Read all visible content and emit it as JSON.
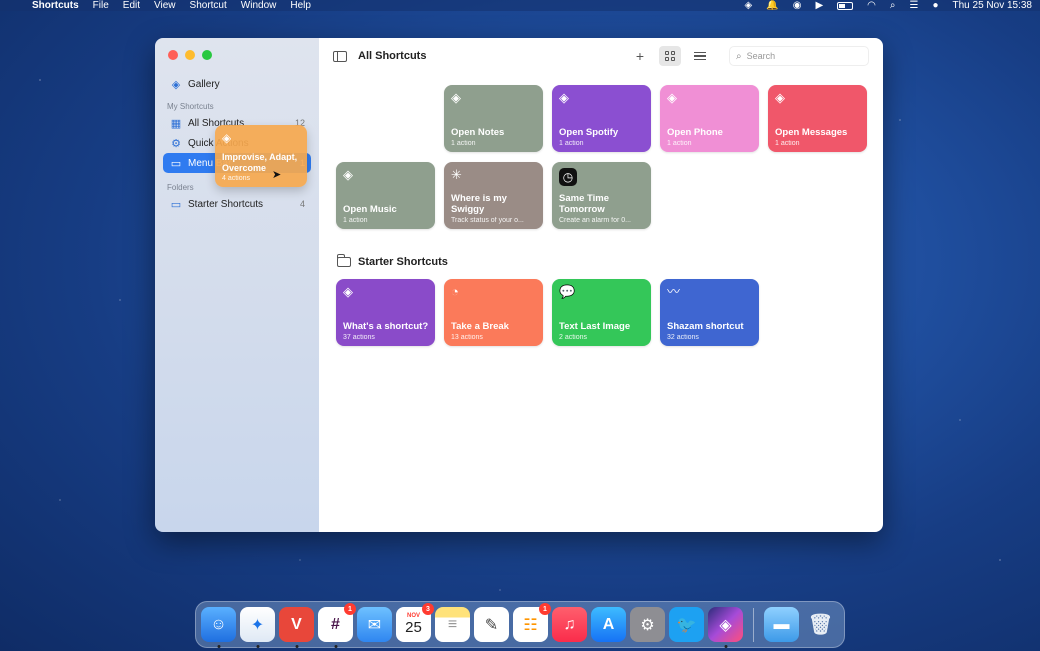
{
  "menubar": {
    "apple": "",
    "app_name": "Shortcuts",
    "menus": [
      "File",
      "Edit",
      "View",
      "Shortcut",
      "Window",
      "Help"
    ],
    "clock": "Thu 25 Nov 15:38"
  },
  "sidebar": {
    "gallery": "Gallery",
    "my_shortcuts_header": "My Shortcuts",
    "items": [
      {
        "label": "All Shortcuts",
        "count": "12"
      },
      {
        "label": "Quick Actions",
        "count": ""
      },
      {
        "label": "Menu Bar",
        "count": "1"
      }
    ],
    "folders_header": "Folders",
    "folders": [
      {
        "label": "Starter Shortcuts",
        "count": "4"
      }
    ]
  },
  "toolbar": {
    "title": "All Shortcuts",
    "add": "+",
    "search_placeholder": "Search"
  },
  "shortcuts": [
    {
      "title": "Open Notes",
      "sub": "1 action",
      "color": "#8f9f8e",
      "icon": "stack-icon"
    },
    {
      "title": "Open Spotify",
      "sub": "1 action",
      "color": "#8b4fd1",
      "icon": "stack-icon"
    },
    {
      "title": "Open Phone",
      "sub": "1 action",
      "color": "#f08fd5",
      "icon": "stack-icon"
    },
    {
      "title": "Open Messages",
      "sub": "1 action",
      "color": "#f0576a",
      "icon": "stack-icon"
    },
    {
      "title": "Open Music",
      "sub": "1 action",
      "color": "#8f9f8e",
      "icon": "stack-icon"
    },
    {
      "title": "Where is my Swiggy",
      "sub": "Track status of your o...",
      "color": "#9a8c86",
      "icon": "spinner-icon"
    },
    {
      "title": "Same Time Tomorrow",
      "sub": "Create an alarm for 0...",
      "color": "#8f9f8e",
      "icon": "clock-icon"
    }
  ],
  "starter": {
    "header": "Starter Shortcuts",
    "items": [
      {
        "title": "What's a shortcut?",
        "sub": "37 actions",
        "color": "#8a4bc9",
        "icon": "stack-icon"
      },
      {
        "title": "Take a Break",
        "sub": "13 actions",
        "color": "#fb7a5a",
        "icon": "timer-icon"
      },
      {
        "title": "Text Last Image",
        "sub": "2 actions",
        "color": "#34c759",
        "icon": "message-icon"
      },
      {
        "title": "Shazam shortcut",
        "sub": "32 actions",
        "color": "#3f66d1",
        "icon": "waveform-icon"
      }
    ]
  },
  "dragged": {
    "title": "Improvise, Adapt, Overcome",
    "sub": "4 actions",
    "color": "#f6a84e"
  },
  "dock": {
    "calendar_month": "NOV",
    "calendar_day": "25",
    "badges": {
      "slack": "1",
      "calendar": "3",
      "reminders": "1"
    }
  }
}
